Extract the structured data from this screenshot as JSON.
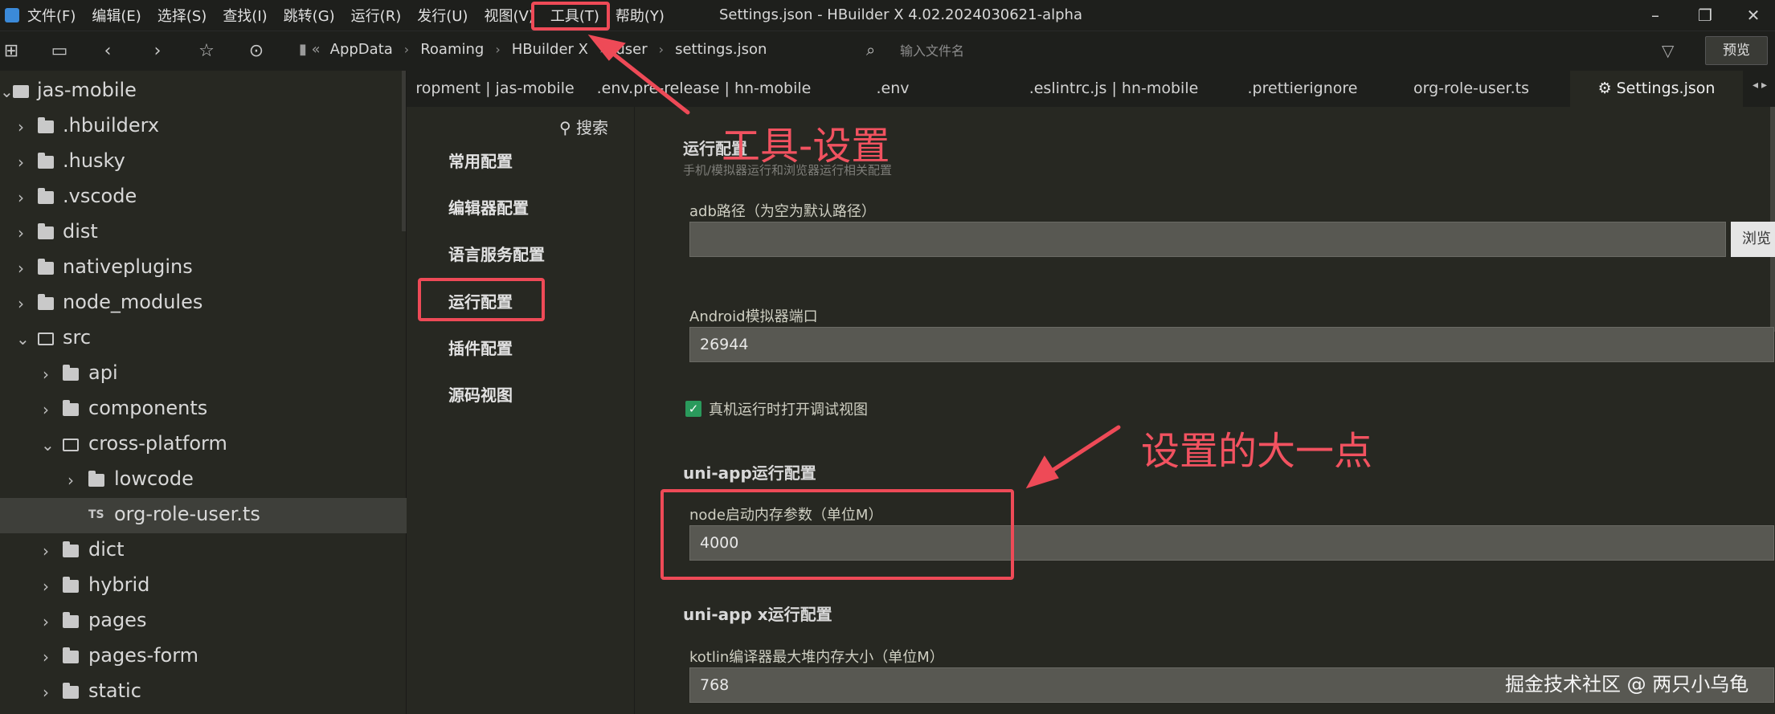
{
  "menubar": {
    "items": [
      "文件(F)",
      "编辑(E)",
      "选择(S)",
      "查找(I)",
      "跳转(G)",
      "运行(R)",
      "发行(U)",
      "视图(V)",
      "工具(T)",
      "帮助(Y)"
    ],
    "window_title": "Settings.json - HBuilder X 4.02.2024030621-alpha"
  },
  "toolbar": {
    "breadcrumb": [
      "AppData",
      "Roaming",
      "HBuilder X",
      "user",
      "settings.json"
    ],
    "search_placeholder": "输入文件名",
    "preview_label": "预览"
  },
  "sidebar": {
    "items": [
      {
        "label": "jas-mobile",
        "kind": "project"
      },
      {
        "label": ".hbuilderx",
        "kind": "folder"
      },
      {
        "label": ".husky",
        "kind": "folder"
      },
      {
        "label": ".vscode",
        "kind": "folder"
      },
      {
        "label": "dist",
        "kind": "folder"
      },
      {
        "label": "nativeplugins",
        "kind": "folder"
      },
      {
        "label": "node_modules",
        "kind": "folder"
      },
      {
        "label": "src",
        "kind": "folder-open"
      },
      {
        "label": "api",
        "kind": "folder"
      },
      {
        "label": "components",
        "kind": "folder"
      },
      {
        "label": "cross-platform",
        "kind": "folder-open"
      },
      {
        "label": "lowcode",
        "kind": "folder"
      },
      {
        "label": "org-role-user.ts",
        "kind": "ts-file",
        "selected": true
      },
      {
        "label": "dict",
        "kind": "folder"
      },
      {
        "label": "hybrid",
        "kind": "folder"
      },
      {
        "label": "pages",
        "kind": "folder"
      },
      {
        "label": "pages-form",
        "kind": "folder"
      },
      {
        "label": "static",
        "kind": "folder"
      }
    ],
    "ts_badge": "TS"
  },
  "tabs": [
    {
      "label": "ropment | jas-mobile"
    },
    {
      "label": ".env.pre-release | hn-mobile"
    },
    {
      "label": ".env"
    },
    {
      "label": ".eslintrc.js | hn-mobile"
    },
    {
      "label": ".prettierignore"
    },
    {
      "label": "org-role-user.ts"
    },
    {
      "label": "Settings.json",
      "active": true
    }
  ],
  "settings_nav": {
    "search_label": "搜索",
    "items": [
      "常用配置",
      "编辑器配置",
      "语言服务配置",
      "运行配置",
      "插件配置",
      "源码视图"
    ],
    "selected": "运行配置"
  },
  "content": {
    "run_section_title": "运行配置",
    "run_section_subtitle": "手机/模拟器运行和浏览器运行相关配置",
    "adb_label": "adb路径（为空为默认路径）",
    "adb_value": "",
    "browse_label": "浏览",
    "android_port_label": "Android模拟器端口",
    "android_port_value": "26944",
    "debug_view_label": "真机运行时打开调试视图",
    "debug_view_checked": true,
    "uniapp_section_title": "uni-app运行配置",
    "node_memory_label": "node启动内存参数（单位M）",
    "node_memory_value": "4000",
    "uniappx_section_title": "uni-app x运行配置",
    "kotlin_heap_label": "kotlin编译器最大堆内存大小（单位M）",
    "kotlin_heap_value": "768"
  },
  "annotations": {
    "tools_settings": "工具-设置",
    "set_larger": "设置的大一点",
    "color": "#ee4a57"
  },
  "watermark": "掘金技术社区 @ 两只小乌龟"
}
